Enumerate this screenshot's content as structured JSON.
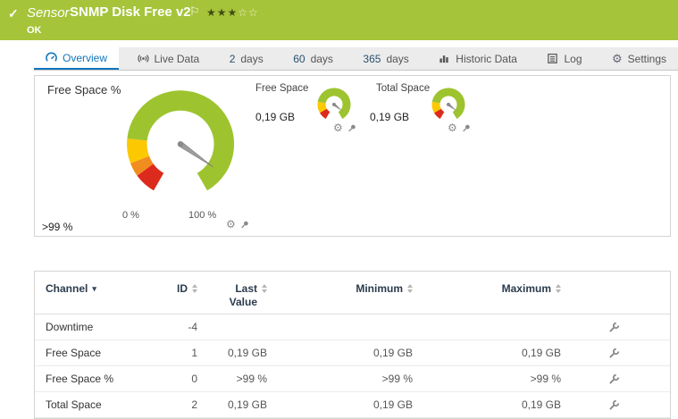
{
  "header": {
    "kind": "Sensor",
    "title": "SNMP Disk Free v2",
    "status": "OK"
  },
  "icons": {
    "check": "✓",
    "flag": "⚐",
    "stars_filled": "★★★",
    "stars_empty": "☆☆",
    "gear": "⚙",
    "channel_filter": "▾"
  },
  "tabs": {
    "overview": "Overview",
    "live_data": "Live Data",
    "days2_num": "2",
    "days2_word": "days",
    "days60_num": "60",
    "days60_word": "days",
    "days365_num": "365",
    "days365_word": "days",
    "historic": "Historic Data",
    "log": "Log",
    "settings": "Settings"
  },
  "gauges": {
    "main_title": "Free Space %",
    "main_value": ">99 %",
    "main_scale_min": "0 %",
    "main_scale_max": "100 %",
    "free_space_title": "Free Space",
    "free_space_value": "0,19 GB",
    "total_space_title": "Total Space",
    "total_space_value": "0,19 GB"
  },
  "table": {
    "headers": {
      "channel": "Channel",
      "id": "ID",
      "last_value": "Last Value",
      "minimum": "Minimum",
      "maximum": "Maximum"
    },
    "rows": [
      {
        "channel": "Downtime",
        "id": "-4",
        "last": "",
        "min": "",
        "max": ""
      },
      {
        "channel": "Free Space",
        "id": "1",
        "last": "0,19 GB",
        "min": "0,19 GB",
        "max": "0,19 GB"
      },
      {
        "channel": "Free Space %",
        "id": "0",
        "last": ">99 %",
        "min": ">99 %",
        "max": ">99 %"
      },
      {
        "channel": "Total Space",
        "id": "2",
        "last": "0,19 GB",
        "min": "0,19 GB",
        "max": "0,19 GB"
      }
    ]
  },
  "colors": {
    "header_green": "#a5c43a",
    "accent_blue": "#1276bc",
    "gauge_green": "#9dc42e",
    "gauge_yellow": "#fcc800",
    "gauge_orange": "#f18c1e",
    "gauge_red": "#dc2b1c"
  }
}
